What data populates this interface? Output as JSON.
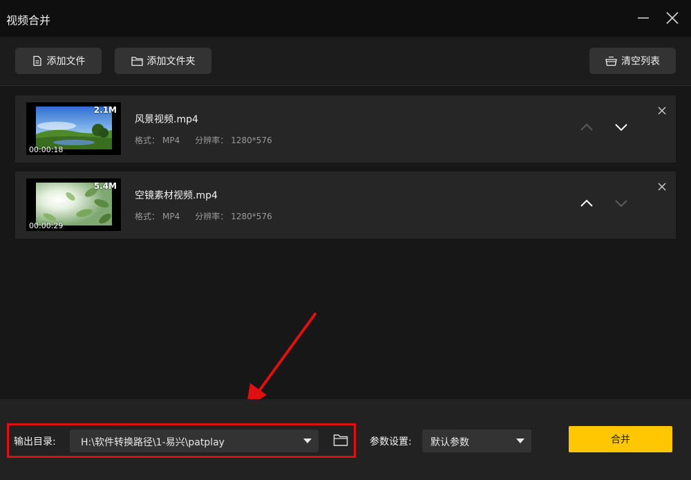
{
  "window": {
    "title": "视频合并"
  },
  "toolbar": {
    "add_file": "添加文件",
    "add_folder": "添加文件夹",
    "clear_list": "清空列表"
  },
  "items": [
    {
      "name": "风景视频.mp4",
      "size": "2.1M",
      "duration": "00:00:18",
      "format_label": "格式：",
      "format": "MP4",
      "resolution_label": "分辨率：",
      "resolution": "1280*576"
    },
    {
      "name": "空镜素材视频.mp4",
      "size": "5.4M",
      "duration": "00:00:29",
      "format_label": "格式：",
      "format": "MP4",
      "resolution_label": "分辨率：",
      "resolution": "1280*576"
    }
  ],
  "bottom": {
    "output_label": "输出目录:",
    "output_path": "H:\\软件转换路径\\1-易兴\\patplay",
    "params_label": "参数设置:",
    "params_value": "默认参数",
    "merge_label": "合并"
  },
  "colors": {
    "accent": "#ffc602",
    "highlight_box": "#e01010",
    "background": "#171717",
    "panel": "#262626"
  },
  "icons": {
    "toolbar": [
      "file-icon",
      "folder-icon",
      "basket-icon"
    ],
    "window": [
      "minimize-icon",
      "close-icon"
    ],
    "item": [
      "arrow-up-icon",
      "arrow-down-icon",
      "close-icon"
    ],
    "bottom": [
      "chevron-down-icon",
      "folder-icon"
    ]
  }
}
